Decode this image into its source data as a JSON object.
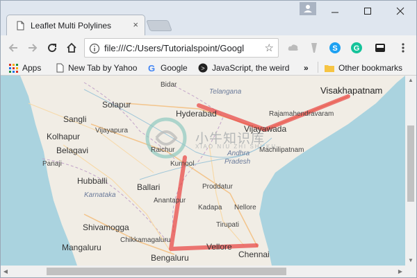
{
  "tab": {
    "title": "Leaflet Multi Polylines",
    "close_glyph": "×"
  },
  "toolbar": {
    "url": "file:///C:/Users/Tutorialspoint/Googl"
  },
  "bookmarks": {
    "items": [
      {
        "label": "Apps"
      },
      {
        "label": "New Tab by Yahoo"
      },
      {
        "label": "Google"
      },
      {
        "label": "JavaScript, the weird"
      },
      {
        "label": "»"
      },
      {
        "label": "Other bookmarks"
      }
    ]
  },
  "map": {
    "cities": [
      {
        "name": "Bidar"
      },
      {
        "name": "Telangana"
      },
      {
        "name": "Solapur"
      },
      {
        "name": "Hyderabad"
      },
      {
        "name": "Sangli"
      },
      {
        "name": "Kolhapur"
      },
      {
        "name": "Vijayapura"
      },
      {
        "name": "Belagavi"
      },
      {
        "name": "Panaji"
      },
      {
        "name": "Hubballi"
      },
      {
        "name": "Karnataka"
      },
      {
        "name": "Raichur"
      },
      {
        "name": "Kurnool"
      },
      {
        "name": "Ballari"
      },
      {
        "name": "Andhra"
      },
      {
        "name": "Pradesh"
      },
      {
        "name": "Proddatur"
      },
      {
        "name": "Anantapur"
      },
      {
        "name": "Kadapa"
      },
      {
        "name": "Nellore"
      },
      {
        "name": "Tirupati"
      },
      {
        "name": "Shivamogga"
      },
      {
        "name": "Chikkamagaluru"
      },
      {
        "name": "Mangaluru"
      },
      {
        "name": "Bengaluru"
      },
      {
        "name": "Vellore"
      },
      {
        "name": "Chennai"
      },
      {
        "name": "Vijayawada"
      },
      {
        "name": "Machilipatnam"
      },
      {
        "name": "Rajamahendravaram"
      },
      {
        "name": "Visakhapatnam"
      }
    ],
    "polyline_color": "#e8403f",
    "watermark_text": "小牛知识库",
    "watermark_sub": "XIAO NIU ZHI SHI KU"
  }
}
